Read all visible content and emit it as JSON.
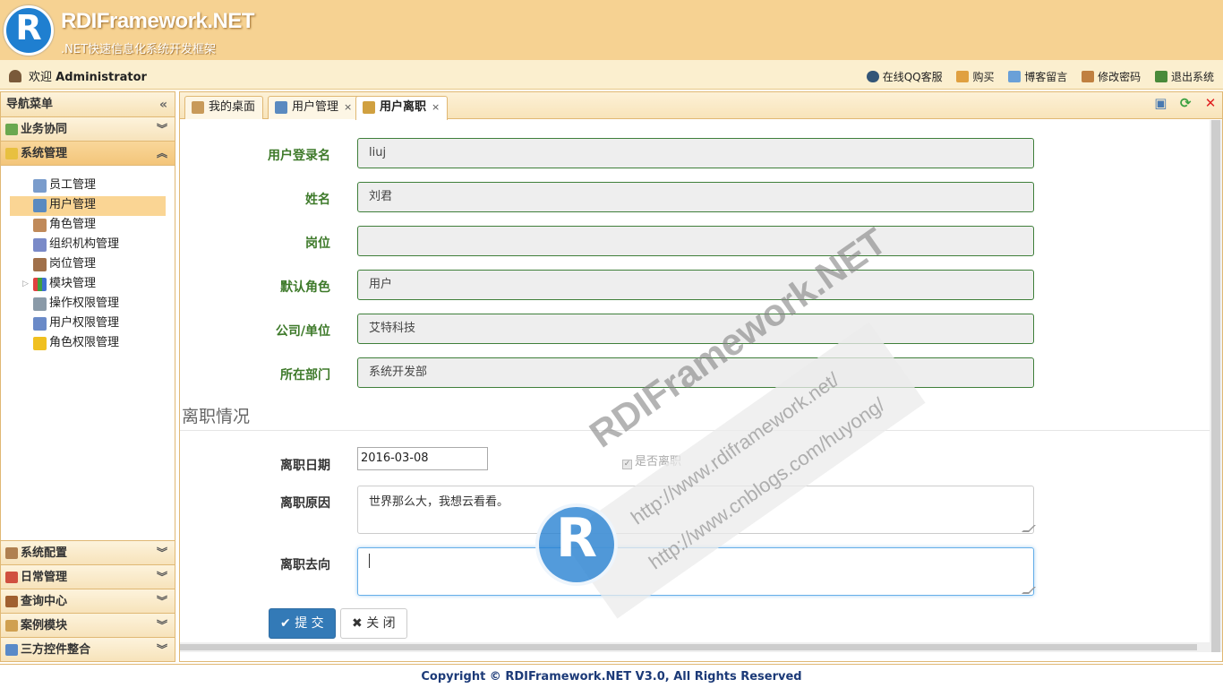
{
  "header": {
    "logo_letter": "R",
    "title": "RDIFramework.NET",
    "subtitle": ".NET快速信息化系统开发框架"
  },
  "topbar": {
    "welcome": "欢迎",
    "user": "Administrator",
    "links": [
      {
        "label": "在线QQ客服",
        "icon": "qq-icon"
      },
      {
        "label": "购买",
        "icon": "cart-icon"
      },
      {
        "label": "博客留言",
        "icon": "mail-icon"
      },
      {
        "label": "修改密码",
        "icon": "key-icon"
      },
      {
        "label": "退出系统",
        "icon": "exit-icon"
      }
    ]
  },
  "sidebar": {
    "title": "导航菜单",
    "collapse_glyph": "«",
    "sections_top": [
      {
        "label": "业务协同",
        "icon": "flow-icon"
      },
      {
        "label": "系统管理",
        "icon": "shield-icon"
      }
    ],
    "tree": [
      {
        "label": "员工管理",
        "icon": "employee-icon"
      },
      {
        "label": "用户管理",
        "icon": "user-icon"
      },
      {
        "label": "角色管理",
        "icon": "role-icon"
      },
      {
        "label": "组织机构管理",
        "icon": "org-icon"
      },
      {
        "label": "岗位管理",
        "icon": "post-icon"
      },
      {
        "label": "模块管理",
        "icon": "module-icon"
      },
      {
        "label": "操作权限管理",
        "icon": "permission-icon"
      },
      {
        "label": "用户权限管理",
        "icon": "user-permission-icon"
      },
      {
        "label": "角色权限管理",
        "icon": "lightning-icon"
      }
    ],
    "selected_index": 1,
    "sections_bottom": [
      {
        "label": "系统配置",
        "icon": "wrench-icon"
      },
      {
        "label": "日常管理",
        "icon": "calendar-icon"
      },
      {
        "label": "查询中心",
        "icon": "book-icon"
      },
      {
        "label": "案例模块",
        "icon": "box-icon"
      },
      {
        "label": "三方控件整合",
        "icon": "gears-icon"
      }
    ]
  },
  "tabs": [
    {
      "label": "我的桌面",
      "closable": false
    },
    {
      "label": "用户管理",
      "closable": true
    },
    {
      "label": "用户离职",
      "closable": true
    }
  ],
  "tab_close_glyph": "×",
  "form": {
    "fields": [
      {
        "label": "用户登录名",
        "value": "liuj"
      },
      {
        "label": "姓名",
        "value": "刘君"
      },
      {
        "label": "岗位",
        "value": ""
      },
      {
        "label": "默认角色",
        "value": "用户"
      },
      {
        "label": "公司/单位",
        "value": "艾特科技"
      },
      {
        "label": "所在部门",
        "value": "系统开发部"
      }
    ],
    "section_title": "离职情况",
    "leave_date_label": "离职日期",
    "leave_date_value": "2016-03-08",
    "is_leave_label": "是否离职",
    "is_leave_checked": true,
    "leave_reason_label": "离职原因",
    "leave_reason_value": "世界那么大，我想云看看。",
    "leave_dest_label": "离职去向",
    "leave_dest_value": "",
    "submit_label": "提 交",
    "close_label": "关 闭"
  },
  "watermark": {
    "brand": "RDIFramework.NET",
    "url1": "http://www.rdiframework.net/",
    "url2": "http://www.cnblogs.com/huyong/"
  },
  "footer": "Copyright © RDIFramework.NET V3.0, All Rights Reserved",
  "colors": {
    "header_bg": "#f6d292",
    "label_green": "#3e7a2a",
    "primary_button": "#337ab7",
    "footer_text": "#1c3a78"
  }
}
